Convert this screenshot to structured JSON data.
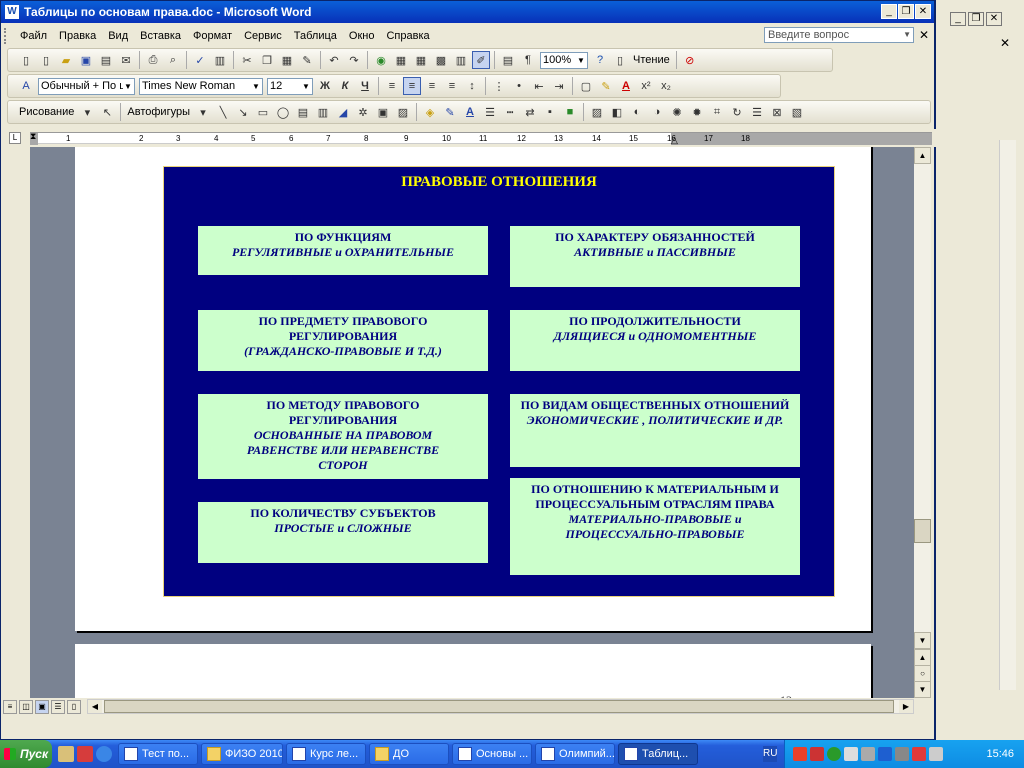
{
  "window": {
    "title": "Таблицы по основам права.doc - Microsoft Word",
    "app_icon": "W"
  },
  "menu": {
    "items": [
      "Файл",
      "Правка",
      "Вид",
      "Вставка",
      "Формат",
      "Сервис",
      "Таблица",
      "Окно",
      "Справка"
    ],
    "ask_placeholder": "Введите вопрос"
  },
  "standard_toolbar": {
    "zoom": "100%",
    "reading_label": "Чтение"
  },
  "formatting_toolbar": {
    "style": "Обычный + По ц",
    "font": "Times New Roman",
    "size": "12",
    "bold": "Ж",
    "italic": "К",
    "underline": "Ч"
  },
  "drawing_toolbar": {
    "draw_label": "Рисование",
    "autoshapes_label": "Автофигуры"
  },
  "ruler": {
    "numbers": [
      "2",
      "1",
      "1",
      "2",
      "3",
      "4",
      "5",
      "6",
      "7",
      "8",
      "9",
      "10",
      "11",
      "12",
      "13",
      "14",
      "15",
      "16",
      "17",
      "18"
    ]
  },
  "diagram": {
    "title": "ПРАВОВЫЕ ОТНОШЕНИЯ",
    "boxes": [
      {
        "heading": "ПО ФУНКЦИЯМ",
        "sub": "РЕГУЛЯТИВНЫЕ     и     ОХРАНИТЕЛЬНЫЕ"
      },
      {
        "heading": "ПО ХАРАКТЕРУ ОБЯЗАННОСТЕЙ",
        "sub": "АКТИВНЫЕ   и   ПАССИВНЫЕ"
      },
      {
        "heading": "ПО ПРЕДМЕТУ ПРАВОВОГО РЕГУЛИРОВАНИЯ",
        "sub": "(ГРАЖДАНСКО-ПРАВОВЫЕ И Т.Д.)"
      },
      {
        "heading": "ПО ПРОДОЛЖИТЕЛЬНОСТИ",
        "sub": "ДЛЯЩИЕСЯ       и      ОДНОМОМЕНТНЫЕ"
      },
      {
        "heading": "ПО МЕТОДУ ПРАВОВОГО РЕГУЛИРОВАНИЯ",
        "sub": "ОСНОВАННЫЕ НА ПРАВОВОМ РАВЕНСТВЕ ИЛИ НЕРАВЕНСТВЕ СТОРОН"
      },
      {
        "heading": "ПО ВИДАМ ОБЩЕСТВЕННЫХ ОТНОШЕНИЙ",
        "sub": "ЭКОНОМИЧЕСКИЕ ,     ПОЛИТИЧЕСКИЕ И ДР."
      },
      {
        "heading": "ПО КОЛИЧЕСТВУ СУБЪЕКТОВ",
        "sub": "ПРОСТЫЕ   и    СЛОЖНЫЕ"
      },
      {
        "heading": "ПО ОТНОШЕНИЮ К МАТЕРИАЛЬНЫМ И ПРОЦЕССУАЛЬНЫМ ОТРАСЛЯМ ПРАВА",
        "sub": "МАТЕРИАЛЬНО-ПРАВОВЫЕ и ПРОЦЕССУАЛЬНО-ПРАВОВЫЕ"
      }
    ]
  },
  "page2_number": "12",
  "taskbar": {
    "start_label": "Пуск",
    "tasks": [
      "Тест по...",
      "ФИЗО 2010",
      "Курс ле...",
      "ДО",
      "Основы ...",
      "Олимпий...",
      "Таблиц..."
    ],
    "lang": "RU",
    "clock": "15:46"
  }
}
